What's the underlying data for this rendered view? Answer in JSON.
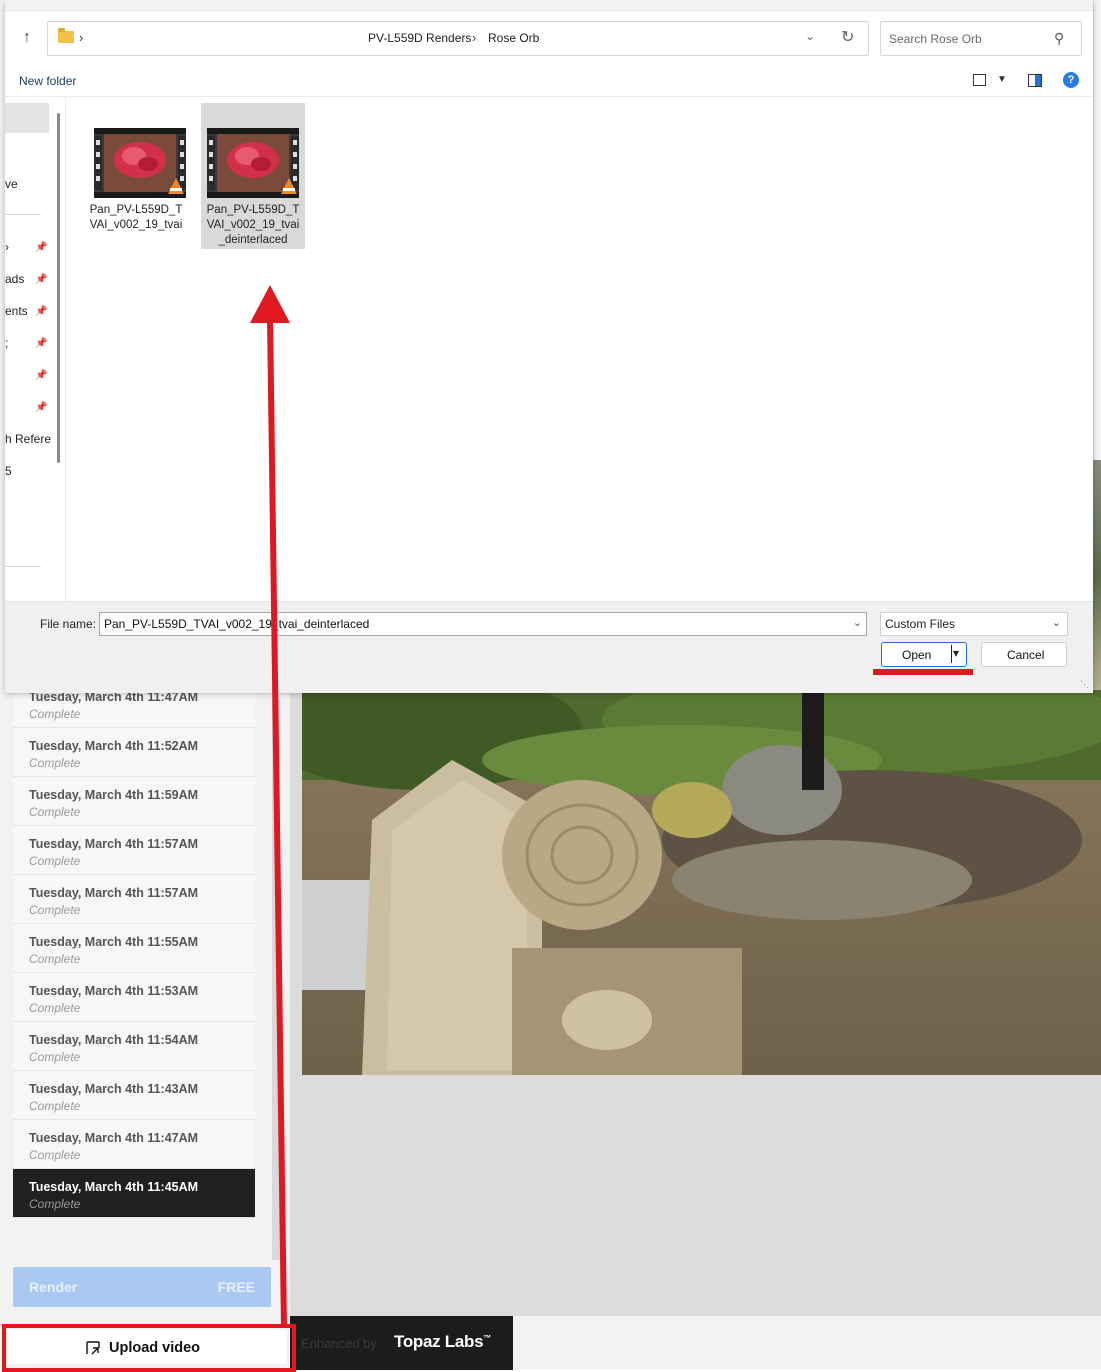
{
  "dialog": {
    "address": {
      "crumbs": [
        "PV-L559D Renders",
        "Rose Orb"
      ]
    },
    "search": {
      "placeholder": "Search Rose Orb"
    },
    "toolbar": {
      "new_folder_label": "New folder"
    },
    "nav_pane": {
      "items": [
        "ve",
        "",
        "ads",
        "ents",
        ";",
        "",
        "",
        "h Refere",
        "5"
      ]
    },
    "files": [
      {
        "name": "Pan_PV-L559D_TVAI_v002_19_tvai",
        "selected": false
      },
      {
        "name": "Pan_PV-L559D_TVAI_v002_19_tvai_deinterlaced",
        "selected": true
      }
    ],
    "filename": {
      "label": "File name:",
      "value": "Pan_PV-L559D_TVAI_v002_19_tvai_deinterlaced"
    },
    "filter": {
      "selected": "Custom Files"
    },
    "buttons": {
      "open": "Open",
      "cancel": "Cancel"
    }
  },
  "app": {
    "history": [
      {
        "date": "Tuesday, March 4th 11:47AM",
        "status": "Complete",
        "active": false
      },
      {
        "date": "Tuesday, March 4th 11:52AM",
        "status": "Complete",
        "active": false
      },
      {
        "date": "Tuesday, March 4th 11:59AM",
        "status": "Complete",
        "active": false
      },
      {
        "date": "Tuesday, March 4th 11:57AM",
        "status": "Complete",
        "active": false
      },
      {
        "date": "Tuesday, March 4th 11:57AM",
        "status": "Complete",
        "active": false
      },
      {
        "date": "Tuesday, March 4th 11:55AM",
        "status": "Complete",
        "active": false
      },
      {
        "date": "Tuesday, March 4th 11:53AM",
        "status": "Complete",
        "active": false
      },
      {
        "date": "Tuesday, March 4th 11:54AM",
        "status": "Complete",
        "active": false
      },
      {
        "date": "Tuesday, March 4th 11:43AM",
        "status": "Complete",
        "active": false
      },
      {
        "date": "Tuesday, March 4th 11:47AM",
        "status": "Complete",
        "active": false
      },
      {
        "date": "Tuesday, March 4th 11:45AM",
        "status": "Complete",
        "active": true
      }
    ],
    "render_button": {
      "label": "Render",
      "price": "FREE"
    },
    "upload_button": {
      "label": "Upload video"
    },
    "footer": {
      "enhanced_by": "Enhanced by",
      "brand": "Topaz Labs",
      "trademark": "™"
    }
  },
  "colors": {
    "annotation_red": "#e0181f",
    "accent_blue": "#2a6fd6",
    "render_blue": "#a9c9f3",
    "active_row": "#202020"
  },
  "icons": [
    "up-arrow-icon",
    "folder-icon",
    "chevron-right-icon",
    "chevron-down-icon",
    "refresh-icon",
    "search-icon",
    "view-icon",
    "preview-pane-icon",
    "help-icon",
    "pin-icon",
    "video-file-icon",
    "upload-icon"
  ]
}
